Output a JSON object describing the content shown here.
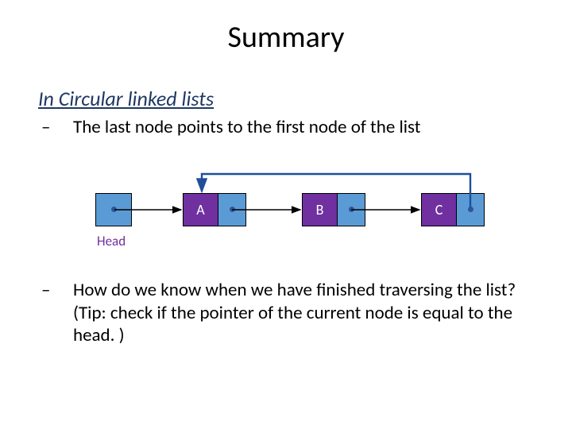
{
  "title": "Summary",
  "subheading": "In Circular linked lists",
  "bullets": {
    "b1": "The last node points to the first node of the list",
    "b2": "How do we know when we have finished traversing the list? (Tip: check if the pointer of the current node is equal to the head. )"
  },
  "diagram": {
    "head_label": "Head",
    "nodes": {
      "a": "A",
      "b": "B",
      "c": "C"
    }
  }
}
